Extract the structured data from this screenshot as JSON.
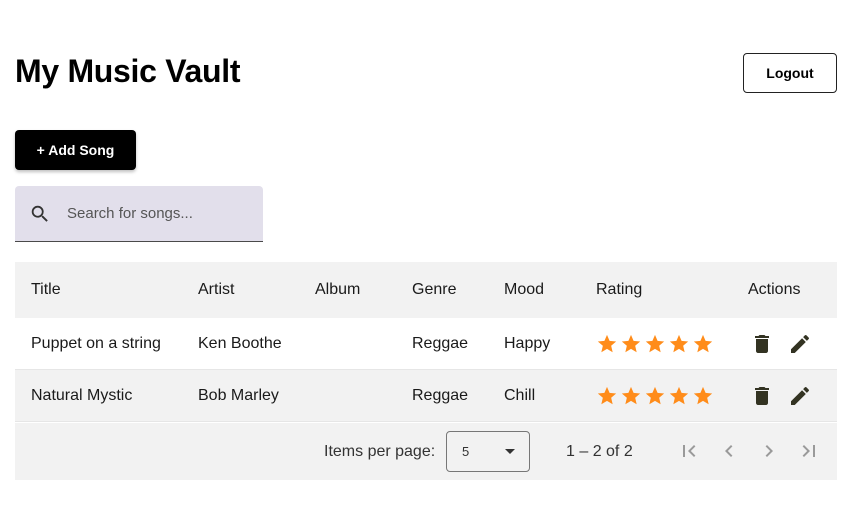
{
  "header": {
    "title": "My Music Vault",
    "logout_label": "Logout"
  },
  "toolbar": {
    "add_song_label": "+ Add Song"
  },
  "search": {
    "placeholder": "Search for songs...",
    "value": "",
    "icon": "search-icon"
  },
  "table": {
    "columns": {
      "title": "Title",
      "artist": "Artist",
      "album": "Album",
      "genre": "Genre",
      "mood": "Mood",
      "rating": "Rating",
      "actions": "Actions"
    },
    "rows": [
      {
        "title": "Puppet on a string",
        "artist": "Ken Boothe",
        "album": "",
        "genre": "Reggae",
        "mood": "Happy",
        "rating": 5,
        "rating_max": 5
      },
      {
        "title": "Natural Mystic",
        "artist": "Bob Marley",
        "album": "",
        "genre": "Reggae",
        "mood": "Chill",
        "rating": 5,
        "rating_max": 5
      }
    ],
    "row_actions": [
      "delete-icon",
      "edit-icon"
    ]
  },
  "paginator": {
    "items_per_page_label": "Items per page:",
    "items_per_page_value": "5",
    "range_label": "1 – 2 of 2",
    "buttons": [
      "first-page-icon",
      "previous-page-icon",
      "next-page-icon",
      "last-page-icon"
    ]
  },
  "colors": {
    "star": "#ff8c1a",
    "search_bg": "#e2dfeb",
    "table_header_bg": "#f2f2f2",
    "primary_button": "#000000",
    "action_icon": "#333322"
  }
}
